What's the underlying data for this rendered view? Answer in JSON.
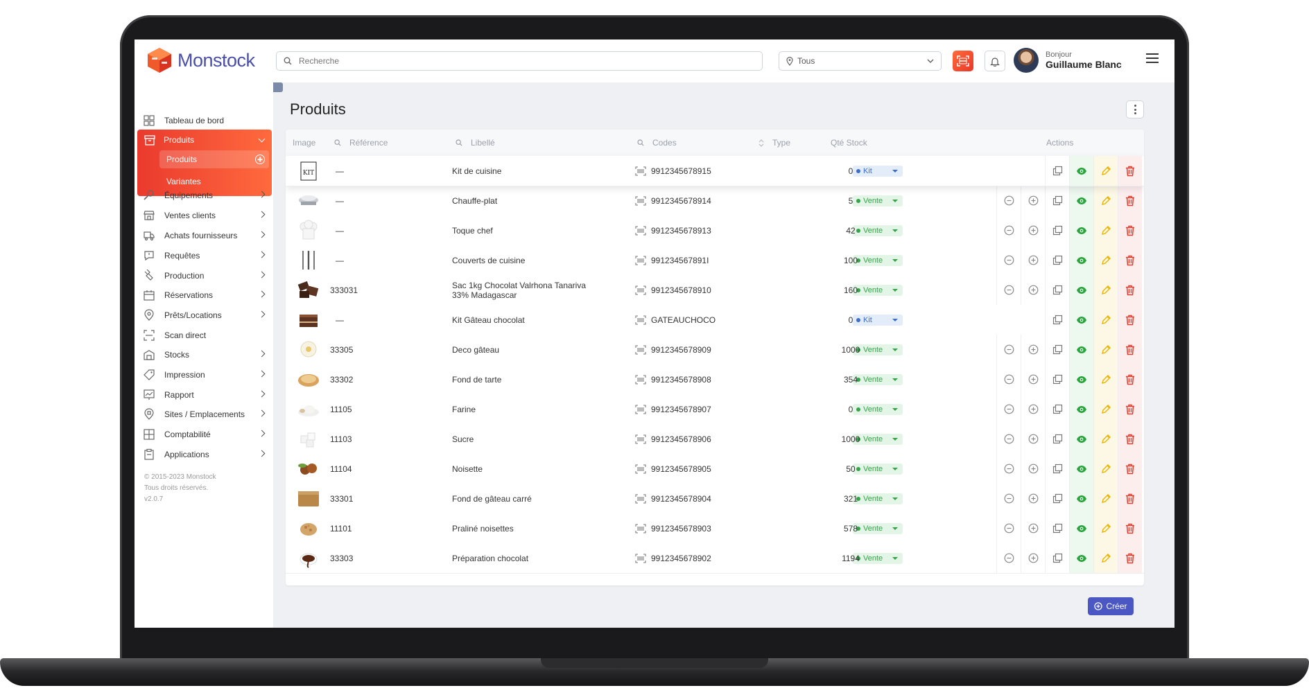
{
  "app": {
    "name": "Monstock"
  },
  "header": {
    "search_placeholder": "Recherche",
    "site_filter_value": "Tous",
    "greeting": "Bonjour",
    "user_name": "Guillaume Blanc"
  },
  "sidebar": {
    "items": [
      {
        "label": "Tableau de bord",
        "icon": "dashboard-icon",
        "has_chevron": false
      },
      {
        "label": "Produits",
        "icon": "box-icon",
        "active": true
      },
      {
        "label": "Équipements",
        "icon": "wrench-icon",
        "has_chevron": true
      },
      {
        "label": "Ventes clients",
        "icon": "shop-icon",
        "has_chevron": true
      },
      {
        "label": "Achats fournisseurs",
        "icon": "truck-icon",
        "has_chevron": true
      },
      {
        "label": "Requêtes",
        "icon": "request-icon",
        "has_chevron": true
      },
      {
        "label": "Production",
        "icon": "production-icon",
        "has_chevron": true
      },
      {
        "label": "Réservations",
        "icon": "calendar-icon",
        "has_chevron": true
      },
      {
        "label": "Prêts/Locations",
        "icon": "location-pin-icon",
        "has_chevron": true
      },
      {
        "label": "Scan direct",
        "icon": "scan-icon",
        "has_chevron": false
      },
      {
        "label": "Stocks",
        "icon": "warehouse-icon",
        "has_chevron": true
      },
      {
        "label": "Impression",
        "icon": "tag-icon",
        "has_chevron": true
      },
      {
        "label": "Rapport",
        "icon": "report-icon",
        "has_chevron": true
      },
      {
        "label": "Sites / Emplacements",
        "icon": "site-icon",
        "has_chevron": true
      },
      {
        "label": "Comptabilité",
        "icon": "accounting-icon",
        "has_chevron": true
      },
      {
        "label": "Applications",
        "icon": "clipboard-icon",
        "has_chevron": true
      }
    ],
    "sub_items": [
      {
        "label": "Produits",
        "selected": true
      },
      {
        "label": "Variantes",
        "selected": false
      }
    ],
    "footer": [
      "© 2015-2023 Monstock",
      "Tous droits réservés.",
      "v2.0.7"
    ]
  },
  "main": {
    "title": "Produits",
    "columns": {
      "image": "Image",
      "reference": "Référence",
      "libelle": "Libellé",
      "codes": "Codes",
      "type": "Type",
      "stock": "Qté Stock",
      "actions": "Actions"
    },
    "rows": [
      {
        "ref": "—",
        "label": "Kit de cuisine",
        "code": "9912345678915",
        "type": "Kit",
        "stock": "0",
        "thumb": "kit-image"
      },
      {
        "ref": "—",
        "label": "Chauffe-plat",
        "code": "9912345678914",
        "type": "Vente",
        "stock": "5",
        "thumb": "chafing-dish-image"
      },
      {
        "ref": "—",
        "label": "Toque chef",
        "code": "9912345678913",
        "type": "Vente",
        "stock": "42",
        "thumb": "chef-hat-image"
      },
      {
        "ref": "—",
        "label": "Couverts de cuisine",
        "code": "991234567891I",
        "type": "Vente",
        "stock": "100",
        "thumb": "cutlery-image"
      },
      {
        "ref": "333031",
        "label": "Sac 1kg Chocolat Valrhona Tanariva",
        "label2": "33% Madagascar",
        "code": "9912345678910",
        "type": "Vente",
        "stock": "160",
        "thumb": "chocolate-image"
      },
      {
        "ref": "—",
        "label": "Kit Gâteau chocolat",
        "code": "GATEAUCHOCO",
        "type": "Kit",
        "stock": "0",
        "thumb": "cake-image"
      },
      {
        "ref": "33305",
        "label": "Deco gâteau",
        "code": "9912345678909",
        "type": "Vente",
        "stock": "1000",
        "thumb": "decoration-image"
      },
      {
        "ref": "33302",
        "label": "Fond de tarte",
        "code": "9912345678908",
        "type": "Vente",
        "stock": "354",
        "thumb": "tart-image"
      },
      {
        "ref": "11105",
        "label": "Farine",
        "code": "9912345678907",
        "type": "Vente",
        "stock": "0",
        "thumb": "flour-image"
      },
      {
        "ref": "11103",
        "label": "Sucre",
        "code": "9912345678906",
        "type": "Vente",
        "stock": "1000",
        "thumb": "sugar-image"
      },
      {
        "ref": "11104",
        "label": "Noisette",
        "code": "9912345678905",
        "type": "Vente",
        "stock": "50",
        "thumb": "hazelnut-image"
      },
      {
        "ref": "33301",
        "label": "Fond de gâteau carré",
        "code": "9912345678904",
        "type": "Vente",
        "stock": "321",
        "thumb": "sponge-image"
      },
      {
        "ref": "11101",
        "label": "Praliné noisettes",
        "code": "9912345678903",
        "type": "Vente",
        "stock": "578",
        "thumb": "praline-image"
      },
      {
        "ref": "33303",
        "label": "Préparation chocolat",
        "code": "9912345678902",
        "type": "Vente",
        "stock": "1194",
        "thumb": "choc-prep-image"
      }
    ],
    "create_label": "Créer"
  },
  "colors": {
    "accent": "#ea3a2e",
    "brand": "#4a4fa8",
    "primary_button": "#4b57c2",
    "vente": "#36a24a",
    "kit": "#3d6ec7"
  }
}
